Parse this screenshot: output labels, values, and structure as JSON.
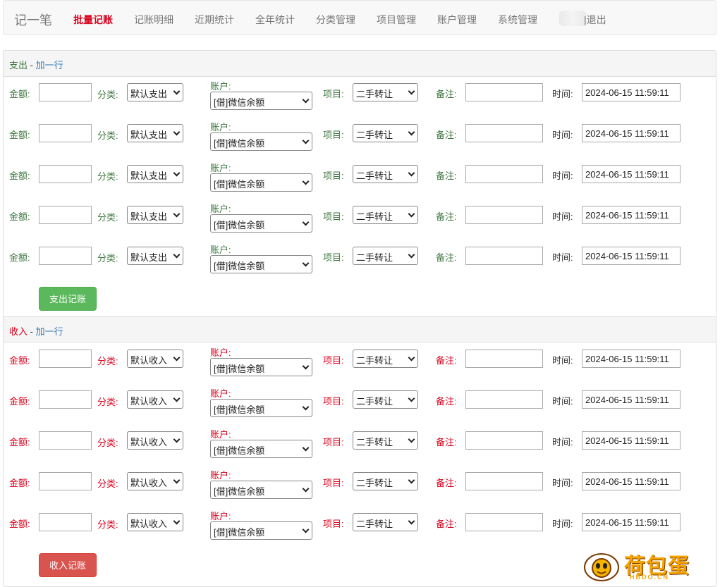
{
  "nav": {
    "brand": "记一笔",
    "items": [
      {
        "label": "批量记账",
        "active": true
      },
      {
        "label": "记账明细"
      },
      {
        "label": "近期统计"
      },
      {
        "label": "全年统计"
      },
      {
        "label": "分类管理"
      },
      {
        "label": "项目管理"
      },
      {
        "label": "账户管理"
      },
      {
        "label": "系统管理"
      }
    ],
    "logout": "|退出"
  },
  "labels": {
    "amount": "金额:",
    "category": "分类:",
    "account": "账户:",
    "project": "项目:",
    "note": "备注:",
    "time": "时间:",
    "separator": " - ",
    "add_row": "加一行"
  },
  "expense": {
    "title": "支出",
    "button": "支出记账",
    "rows": [
      {
        "amount": "",
        "category": "默认支出",
        "account": "[借]微信余额",
        "project": "二手转让",
        "note": "",
        "time": "2024-06-15 11:59:11"
      },
      {
        "amount": "",
        "category": "默认支出",
        "account": "[借]微信余额",
        "project": "二手转让",
        "note": "",
        "time": "2024-06-15 11:59:11"
      },
      {
        "amount": "",
        "category": "默认支出",
        "account": "[借]微信余额",
        "project": "二手转让",
        "note": "",
        "time": "2024-06-15 11:59:11"
      },
      {
        "amount": "",
        "category": "默认支出",
        "account": "[借]微信余额",
        "project": "二手转让",
        "note": "",
        "time": "2024-06-15 11:59:11"
      },
      {
        "amount": "",
        "category": "默认支出",
        "account": "[借]微信余额",
        "project": "二手转让",
        "note": "",
        "time": "2024-06-15 11:59:11"
      }
    ]
  },
  "income": {
    "title": "收入",
    "button": "收入记账",
    "rows": [
      {
        "amount": "",
        "category": "默认收入",
        "account": "[借]微信余额",
        "project": "二手转让",
        "note": "",
        "time": "2024-06-15 11:59:11"
      },
      {
        "amount": "",
        "category": "默认收入",
        "account": "[借]微信余额",
        "project": "二手转让",
        "note": "",
        "time": "2024-06-15 11:59:11"
      },
      {
        "amount": "",
        "category": "默认收入",
        "account": "[借]微信余额",
        "project": "二手转让",
        "note": "",
        "time": "2024-06-15 11:59:11"
      },
      {
        "amount": "",
        "category": "默认收入",
        "account": "[借]微信余额",
        "project": "二手转让",
        "note": "",
        "time": "2024-06-15 11:59:11"
      },
      {
        "amount": "",
        "category": "默认收入",
        "account": "[借]微信余额",
        "project": "二手转让",
        "note": "",
        "time": "2024-06-15 11:59:11"
      }
    ]
  },
  "watermark": {
    "text": "荷包蛋",
    "sub": "HBDO.CN"
  },
  "colors": {
    "expense": "#3c763d",
    "income": "#d9001b",
    "link": "#337ab7",
    "expense_button": "#5cb85c",
    "income_button": "#d9534f"
  }
}
